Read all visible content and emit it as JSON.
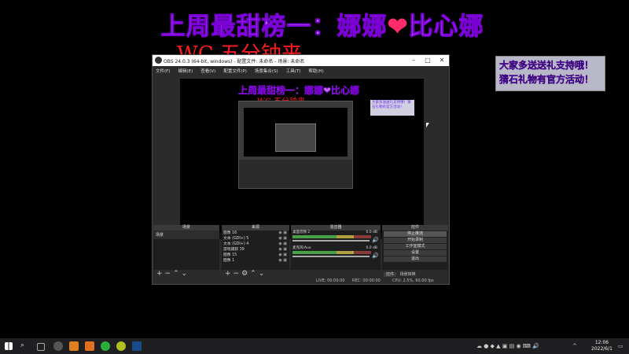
{
  "overlay": {
    "title_prefix": "上周最甜榜一：娜娜",
    "title_heart": "❤",
    "title_suffix": "比心娜",
    "wc_text": "WC 五分钟来",
    "notice_line1": "大家多送送礼支持哦！",
    "notice_line2": "猜石礼物有官方活动！"
  },
  "obs": {
    "window_title": "OBS 24.0.3 (64-bit, windows) - 配置文件: 未命名 - 场景: 未命名",
    "menu": [
      "文件(F)",
      "编辑(E)",
      "查看(V)",
      "配置文件(P)",
      "场景集合(S)",
      "工具(T)",
      "帮助(H)"
    ],
    "preview": {
      "title": "上周最甜榜一：娜娜❤比心娜",
      "wc_text": "WC 五分钟来",
      "notice": "大家多送送礼支持哦！猜石礼物有官方活动！"
    },
    "docks": {
      "scenes_header": "场景",
      "sources_header": "来源",
      "mixer_header": "混音器",
      "controls_header": "控件",
      "scenes": [
        "场景"
      ],
      "sources": [
        "图像 16",
        "文本 (GDI+) 5",
        "文本 (GDI+) 4",
        "游戏捕获 39",
        "图像 15",
        "图像 1"
      ],
      "mixer": [
        {
          "name": "桌面音频 2",
          "db": "0.0 dB"
        },
        {
          "name": "麦克风/Aux",
          "db": "0.0 dB"
        }
      ],
      "controls": [
        "停止推流",
        "开始录制",
        "工作室模式",
        "设置",
        "退出"
      ],
      "tabs": [
        "控件",
        "场景转换"
      ]
    },
    "status": {
      "live": "LIVE: 00:00:00",
      "rec": "REC: 00:00:00",
      "cpu": "CPU: 2.5%, 60.00 fps"
    }
  },
  "taskbar": {
    "time": "12:06",
    "date": "2022/6/1"
  }
}
